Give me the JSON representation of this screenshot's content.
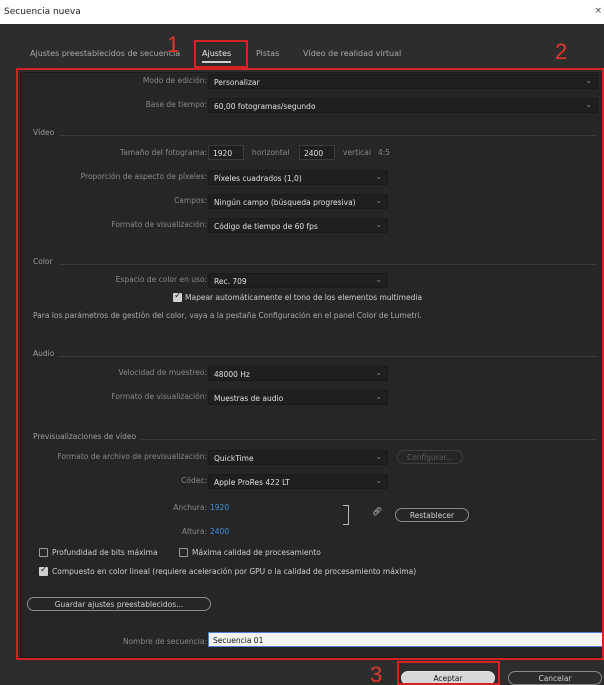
{
  "window": {
    "title": "Secuencia nueva",
    "close_glyph": "×"
  },
  "tabs": [
    {
      "label": "Ajustes preestablecidos de secuencia"
    },
    {
      "label": "Ajustes"
    },
    {
      "label": "Pistas"
    },
    {
      "label": "Vídeo de realidad virtual"
    }
  ],
  "annotations": {
    "one": "1",
    "two": "2",
    "three": "3"
  },
  "general": {
    "mode_label": "Modo de edición:",
    "mode_value": "Personalizar",
    "timebase_label": "Base de tiempo:",
    "timebase_value": "60,00 fotogramas/segundo"
  },
  "video": {
    "section": "Vídeo",
    "frame_size_label": "Tamaño del fotograma:",
    "frame_w": "1920",
    "horizontal": "horizontal",
    "frame_h": "2400",
    "vertical": "vertical",
    "ratio": "4:5",
    "par_label": "Proporción de aspecto de píxeles:",
    "par_value": "Píxeles cuadrados (1,0)",
    "fields_label": "Campos:",
    "fields_value": "Ningún campo (búsqueda progresiva)",
    "display_label": "Formato de visualización:",
    "display_value": "Código de tiempo de 60 fps"
  },
  "color": {
    "section": "Color",
    "space_label": "Espacio de color en uso:",
    "space_value": "Rec. 709",
    "tonemap": "Mapear automáticamente el tono de los elementos multimedia",
    "note": "Para los parámetros de gestión del color, vaya a la pestaña Configuración en el panel Color de Lumetri."
  },
  "audio": {
    "section": "Audio",
    "rate_label": "Velocidad de muestreo:",
    "rate_value": "48000 Hz",
    "display_label": "Formato de visualización:",
    "display_value": "Muestras de audio"
  },
  "preview": {
    "section": "Previsualizaciones de vídeo",
    "format_label": "Formato de archivo de previsualización:",
    "format_value": "QuickTime",
    "configure": "Configurar...",
    "codec_label": "Códec:",
    "codec_value": "Apple ProRes 422 LT",
    "width_label": "Anchura:",
    "width_value": "1920",
    "height_label": "Altura:",
    "height_value": "2400",
    "reset": "Restablecer"
  },
  "options": {
    "max_depth": "Profundidad de bits máxima",
    "max_quality": "Máxima calidad de procesamiento",
    "linear": "Compuesto en color lineal (requiere aceleración por GPU o la calidad de procesamiento máxima)"
  },
  "save_preset": "Guardar ajustes preestablecidos...",
  "sequence": {
    "name_label": "Nombre de secuencia:",
    "name_value": "Secuencia 01"
  },
  "buttons": {
    "ok": "Aceptar",
    "cancel": "Cancelar"
  }
}
